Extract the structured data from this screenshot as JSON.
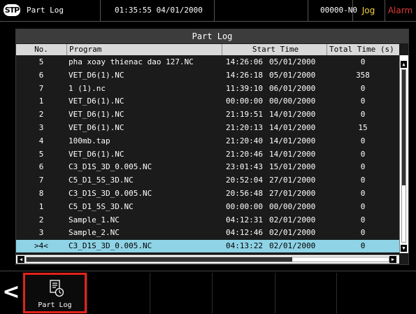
{
  "topbar": {
    "logo": "STP",
    "title": "Part Log",
    "datetime": "01:35:55 04/01/2000",
    "program_no": "00000-N0",
    "mode": "Jog",
    "alarm": "Alarm"
  },
  "panel": {
    "title": "Part Log",
    "headers": {
      "no": "No.",
      "program": "Program",
      "start_time": "Start Time",
      "total_time": "Total Time (s)"
    },
    "rows": [
      {
        "no": "5",
        "program": "pha xoay thienac dao 127.NC",
        "time": "14:26:06",
        "date": "05/01/2000",
        "total": "0"
      },
      {
        "no": "6",
        "program": "VET_D6(1).NC",
        "time": "14:26:18",
        "date": "05/01/2000",
        "total": "358"
      },
      {
        "no": "7",
        "program": "1 (1).nc",
        "time": "11:39:10",
        "date": "06/01/2000",
        "total": "0"
      },
      {
        "no": "1",
        "program": "VET_D6(1).NC",
        "time": "00:00:00",
        "date": "00/00/2000",
        "total": "0"
      },
      {
        "no": "2",
        "program": "VET_D6(1).NC",
        "time": "21:19:51",
        "date": "14/01/2000",
        "total": "0"
      },
      {
        "no": "3",
        "program": "VET_D6(1).NC",
        "time": "21:20:13",
        "date": "14/01/2000",
        "total": "15"
      },
      {
        "no": "4",
        "program": "100mb.tap",
        "time": "21:20:40",
        "date": "14/01/2000",
        "total": "0"
      },
      {
        "no": "5",
        "program": "VET_D6(1).NC",
        "time": "21:20:46",
        "date": "14/01/2000",
        "total": "0"
      },
      {
        "no": "6",
        "program": "C3_D1S_3D_0.005.NC",
        "time": "23:01:43",
        "date": "15/01/2000",
        "total": "0"
      },
      {
        "no": "7",
        "program": "C5_D1_5S_3D.NC",
        "time": "20:52:04",
        "date": "27/01/2000",
        "total": "0"
      },
      {
        "no": "8",
        "program": "C3_D1S_3D_0.005.NC",
        "time": "20:56:48",
        "date": "27/01/2000",
        "total": "0"
      },
      {
        "no": "1",
        "program": "C5_D1_5S_3D.NC",
        "time": "00:00:00",
        "date": "00/00/2000",
        "total": "0"
      },
      {
        "no": "2",
        "program": "Sample_1.NC",
        "time": "04:12:31",
        "date": "02/01/2000",
        "total": "0"
      },
      {
        "no": "3",
        "program": "Sample_2.NC",
        "time": "04:12:46",
        "date": "02/01/2000",
        "total": "0"
      },
      {
        "no": ">4<",
        "program": "C3_D1S_3D_0.005.NC",
        "time": "04:13:22",
        "date": "02/01/2000",
        "total": "0",
        "selected": true
      }
    ]
  },
  "scroll": {
    "up": "▲",
    "down": "▼",
    "left": "◀",
    "right": "▶"
  },
  "softkeys": {
    "back": "<",
    "items": [
      {
        "label": "Part Log",
        "icon": "part-log-icon",
        "active": true
      },
      {
        "label": ""
      },
      {
        "label": ""
      },
      {
        "label": ""
      },
      {
        "label": ""
      },
      {
        "label": ""
      }
    ]
  },
  "colors": {
    "selected_row": "#8ed3e6",
    "jog": "#f4d23c",
    "alarm": "#e13a3a",
    "active_key_border": "#e2211c"
  }
}
